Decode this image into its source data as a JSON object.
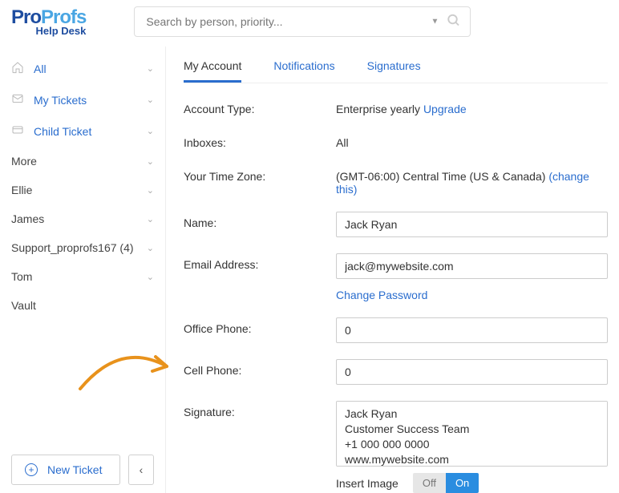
{
  "brand": {
    "pro": "Pro",
    "profs": "Profs",
    "sub": "Help Desk"
  },
  "search": {
    "placeholder": "Search by person, priority..."
  },
  "sidebar": {
    "items": [
      {
        "label": "All",
        "icon": "home-icon",
        "blue": true,
        "chev": true
      },
      {
        "label": "My Tickets",
        "icon": "inbox-icon",
        "blue": true,
        "chev": true
      },
      {
        "label": "Child Ticket",
        "icon": "card-icon",
        "blue": true,
        "chev": true
      },
      {
        "label": "More",
        "icon": "",
        "blue": false,
        "chev": true
      },
      {
        "label": "Ellie",
        "icon": "",
        "blue": false,
        "chev": true
      },
      {
        "label": "James",
        "icon": "",
        "blue": false,
        "chev": true
      },
      {
        "label": "Support_proprofs167 (4)",
        "icon": "",
        "blue": false,
        "chev": true
      },
      {
        "label": "Tom",
        "icon": "",
        "blue": false,
        "chev": true
      },
      {
        "label": "Vault",
        "icon": "",
        "blue": false,
        "chev": false
      }
    ],
    "new_ticket": "New Ticket"
  },
  "tabs": {
    "my_account": "My Account",
    "notifications": "Notifications",
    "signatures": "Signatures"
  },
  "form": {
    "account_type_label": "Account Type:",
    "account_type_value": "Enterprise yearly",
    "upgrade": "Upgrade",
    "inboxes_label": "Inboxes:",
    "inboxes_value": "All",
    "timezone_label": "Your Time Zone:",
    "timezone_value": "(GMT-06:00) Central Time (US & Canada)",
    "change_this": "(change this)",
    "name_label": "Name:",
    "name_value": "Jack Ryan",
    "email_label": "Email Address:",
    "email_value": "jack@mywebsite.com",
    "change_password": "Change Password",
    "office_phone_label": "Office Phone:",
    "office_phone_value": "0",
    "cell_phone_label": "Cell Phone:",
    "cell_phone_value": "0",
    "signature_label": "Signature:",
    "signature_value": "Jack Ryan\nCustomer Success Team\n+1 000 000 0000\nwww.mywebsite.com",
    "insert_image": "Insert Image",
    "toggle_off": "Off",
    "toggle_on": "On"
  }
}
